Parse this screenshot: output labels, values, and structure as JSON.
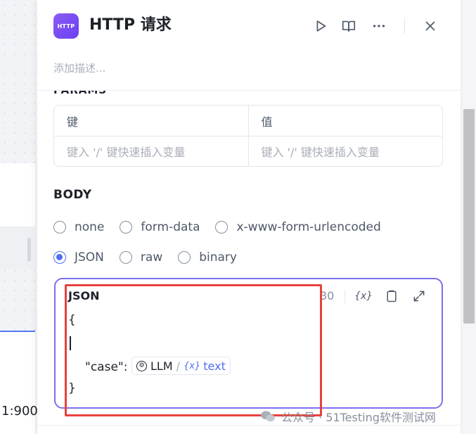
{
  "header": {
    "icon_text": "HTTP",
    "title": "HTTP 请求",
    "description_placeholder": "添加描述..."
  },
  "section_cut_label": "PARAMS",
  "kv_table": {
    "key_header": "键",
    "value_header": "值",
    "key_placeholder": "键入 '/' 键快速插入变量",
    "value_placeholder": "键入 '/' 键快速插入变量"
  },
  "body": {
    "title": "BODY",
    "options_row1": [
      "none",
      "form-data",
      "x-www-form-urlencoded"
    ],
    "options_row2": [
      "JSON",
      "raw",
      "binary"
    ],
    "selected": "JSON"
  },
  "editor": {
    "title": "JSON",
    "count": "30",
    "var_button": "{x}",
    "open_brace": "{",
    "close_brace": "}",
    "case_key": "\"case\":",
    "chip_node": "LLM",
    "chip_slash": "/",
    "chip_var_icon": "{x}",
    "chip_var": "text"
  },
  "background": {
    "number_text": "1:900"
  },
  "watermark": {
    "text": "公众号 · 51Testing软件测试网"
  },
  "colors": {
    "accent": "#4e6ef2",
    "editor_border": "#7a70f0",
    "annotation": "#e8413c",
    "icon_gradient": "#7a4ff3"
  }
}
